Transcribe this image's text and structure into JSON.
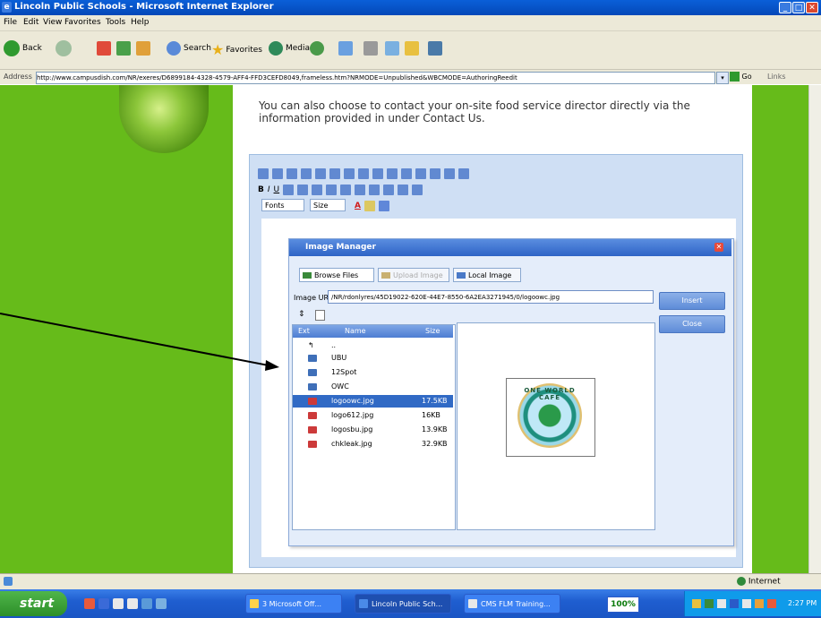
{
  "window": {
    "title": "Lincoln Public Schools - Microsoft Internet Explorer",
    "controls": [
      "minimize",
      "maximize",
      "close"
    ]
  },
  "menu": [
    "File",
    "Edit",
    "View",
    "Favorites",
    "Tools",
    "Help"
  ],
  "toolbar": {
    "back_label": "Back",
    "search_label": "Search",
    "favorites_label": "Favorites",
    "media_label": "Media"
  },
  "address": {
    "label": "Address",
    "url": "http://www.campusdish.com/NR/exeres/D6899184-4328-4579-AFF4-FFD3CEFD8049,frameless.htm?NRMODE=Unpublished&WBCMODE=AuthoringReedit",
    "go_label": "Go",
    "links_label": "Links"
  },
  "page": {
    "intro_text": "You can also choose to contact your on-site food service director directly via the information provided in under Contact Us.",
    "fonts_select": "Fonts",
    "size_select": "Size"
  },
  "image_manager": {
    "title": "Image Manager",
    "tabs": [
      "Browse Files",
      "Upload Image",
      "Local Image"
    ],
    "url_label": "Image URL:",
    "url_value": "/NR/rdonlyres/45D19022-620E-44E7-8550-6A2EA3271945/0/logoowc.jpg",
    "insert_label": "Insert",
    "close_label": "Close",
    "columns": [
      "Ext",
      "Name",
      "Size"
    ],
    "files": [
      {
        "name": "..",
        "size": "",
        "type": "up"
      },
      {
        "name": "UBU",
        "size": "",
        "type": "folder"
      },
      {
        "name": "12Spot",
        "size": "",
        "type": "folder"
      },
      {
        "name": "OWC",
        "size": "",
        "type": "folder"
      },
      {
        "name": "logoowc.jpg",
        "size": "17.5KB",
        "type": "jpg",
        "selected": true
      },
      {
        "name": "logo612.jpg",
        "size": "16KB",
        "type": "jpg"
      },
      {
        "name": "logosbu.jpg",
        "size": "13.9KB",
        "type": "jpg"
      },
      {
        "name": "chkleak.jpg",
        "size": "32.9KB",
        "type": "jpg"
      }
    ],
    "preview_logo_text": "ONE WORLD CAFE"
  },
  "status": {
    "zone": "Internet"
  },
  "taskbar": {
    "start_label": "start",
    "tasks": [
      "3 Microsoft Off...",
      "Lincoln Public Sch...",
      "CMS FLM Training..."
    ],
    "zoom": "100%",
    "clock": "2:27 PM"
  },
  "colors": {
    "page_green": "#66bb1a",
    "xp_blue": "#0a5fd8",
    "selection_blue": "#316ac5"
  }
}
